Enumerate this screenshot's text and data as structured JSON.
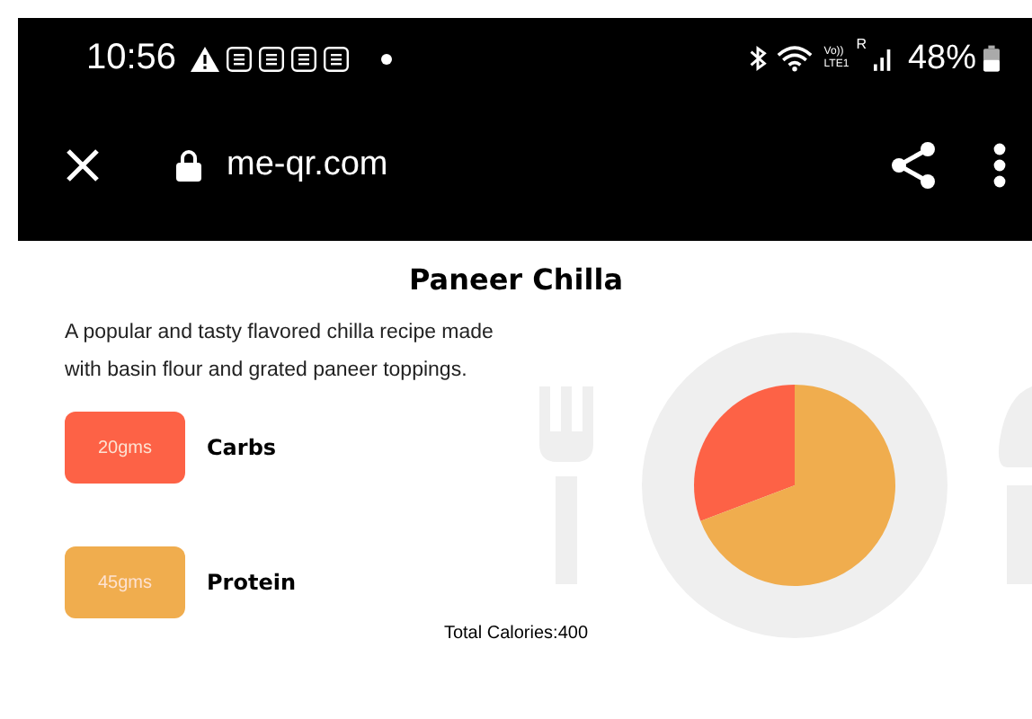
{
  "status_bar": {
    "time": "10:56",
    "volte": "Vo))",
    "lte": "LTE1",
    "roaming": "R",
    "battery": "48%"
  },
  "browser_bar": {
    "url": "me-qr.com"
  },
  "recipe": {
    "title": "Paneer Chilla",
    "description": "A popular and tasty flavored chilla recipe made with basin flour and grated paneer toppings.",
    "nutrients": [
      {
        "amount": "20gms",
        "name": "Carbs",
        "color": "#fd6246"
      },
      {
        "amount": "45gms",
        "name": "Protein",
        "color": "#f0ad4e"
      }
    ],
    "total": "Total Calories:400"
  }
}
